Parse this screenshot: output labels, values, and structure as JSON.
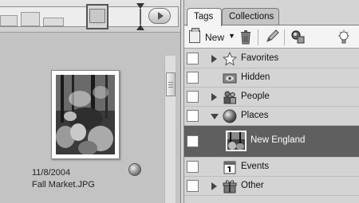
{
  "gallery": {
    "photo": {
      "date": "11/8/2004",
      "filename": "Fall Market.JPG"
    }
  },
  "organizer": {
    "tabs": [
      {
        "label": "Tags",
        "active": true
      },
      {
        "label": "Collections",
        "active": false
      }
    ],
    "toolbar": {
      "new_label": "New"
    },
    "tags": [
      {
        "label": "Favorites",
        "icon": "star-icon",
        "expandable": true,
        "expanded": false
      },
      {
        "label": "Hidden",
        "icon": "hidden-icon",
        "expandable": false
      },
      {
        "label": "People",
        "icon": "people-icon",
        "expandable": true,
        "expanded": false
      },
      {
        "label": "Places",
        "icon": "globe-icon",
        "expandable": true,
        "expanded": true
      },
      {
        "label": "New England",
        "icon": "photo-thumbnail",
        "selected": true
      },
      {
        "label": "Events",
        "icon": "calendar-icon",
        "expandable": false
      },
      {
        "label": "Other",
        "icon": "gift-icon",
        "expandable": true,
        "expanded": false
      }
    ]
  },
  "colors": {
    "selected_row": "#5f5f5f",
    "pane_background": "#d4d4d4"
  }
}
